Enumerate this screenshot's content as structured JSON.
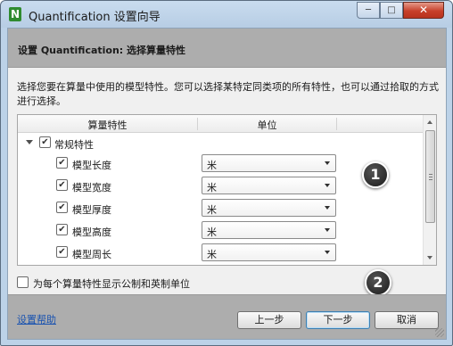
{
  "window": {
    "title": "Quantification 设置向导",
    "app_icon_letter": "N",
    "minimize_icon": "minimize-icon",
    "maximize_icon": "maximize-icon",
    "close_icon": "close-icon"
  },
  "page": {
    "heading": "设置 Quantification: 选择算量特性",
    "instruction": "选择您要在算量中使用的模型特性。您可以选择某特定同类项的所有特性，也可以通过拾取的方式进行选择。"
  },
  "grid": {
    "columns": [
      "算量特性",
      "单位"
    ],
    "group": {
      "label": "常规特性",
      "checked": true,
      "expanded": true
    },
    "rows": [
      {
        "label": "模型长度",
        "checked": true,
        "unit": "米"
      },
      {
        "label": "模型宽度",
        "checked": true,
        "unit": "米"
      },
      {
        "label": "模型厚度",
        "checked": true,
        "unit": "米"
      },
      {
        "label": "模型高度",
        "checked": true,
        "unit": "米"
      },
      {
        "label": "模型周长",
        "checked": true,
        "unit": "米"
      }
    ]
  },
  "callouts": [
    "1",
    "2"
  ],
  "options": {
    "dual_units_label": "为每个算量特性显示公制和英制单位",
    "dual_units_checked": false
  },
  "footer": {
    "help_link": "设置帮助",
    "back": "上一步",
    "next": "下一步",
    "cancel": "取消"
  }
}
